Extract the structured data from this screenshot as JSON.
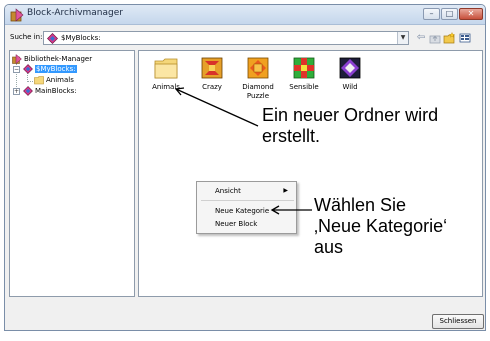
{
  "window": {
    "title": "Block-Archivmanager",
    "icon": "block-archive-icon",
    "controls": [
      "minimize-icon",
      "maximize-icon",
      "close-icon"
    ]
  },
  "toolbar": {
    "search_label": "Suche in:",
    "location_value": "$MyBlocks:",
    "icons": [
      "back-arrow-icon",
      "up-folder-icon",
      "new-folder-icon",
      "view-menu-icon"
    ]
  },
  "tree": {
    "items": [
      {
        "label": "Bibliothek-Manager",
        "icon": "library-icon",
        "level": 0
      },
      {
        "label": "$MyBlocks:",
        "icon": "blocks-diamond-icon",
        "level": 1,
        "expanded": true,
        "selected": true
      },
      {
        "label": "Animals",
        "icon": "folder-icon",
        "level": 2
      },
      {
        "label": "MainBlocks:",
        "icon": "blocks-diamond-icon",
        "level": 1,
        "expanded": false
      }
    ]
  },
  "content": {
    "tiles": [
      {
        "label": "Animals",
        "icon": "folder-icon"
      },
      {
        "label": "Crazy",
        "icon": "block-crazy-icon"
      },
      {
        "label": "Diamond Puzzle",
        "icon": "block-diamond-puzzle-icon"
      },
      {
        "label": "Sensible",
        "icon": "block-sensible-icon"
      },
      {
        "label": "Wild",
        "icon": "block-wild-icon"
      }
    ]
  },
  "context_menu": {
    "items": [
      {
        "label": "Ansicht",
        "has_submenu": true
      },
      {
        "label": "Neue Kategorie"
      },
      {
        "label": "Neuer Block"
      }
    ]
  },
  "footer": {
    "close_label": "Schliessen"
  },
  "annotations": {
    "callout_1_line1": "Ein neuer Ordner wird",
    "callout_1_line2": "erstellt.",
    "callout_2_line1": "Wählen Sie",
    "callout_2_line2": "‚Neue Kategorie‘",
    "callout_2_line3": "aus"
  },
  "colors": {
    "selection": "#3399ff",
    "folder": "#f5d77a",
    "titlebar": "#c5d7ec"
  }
}
